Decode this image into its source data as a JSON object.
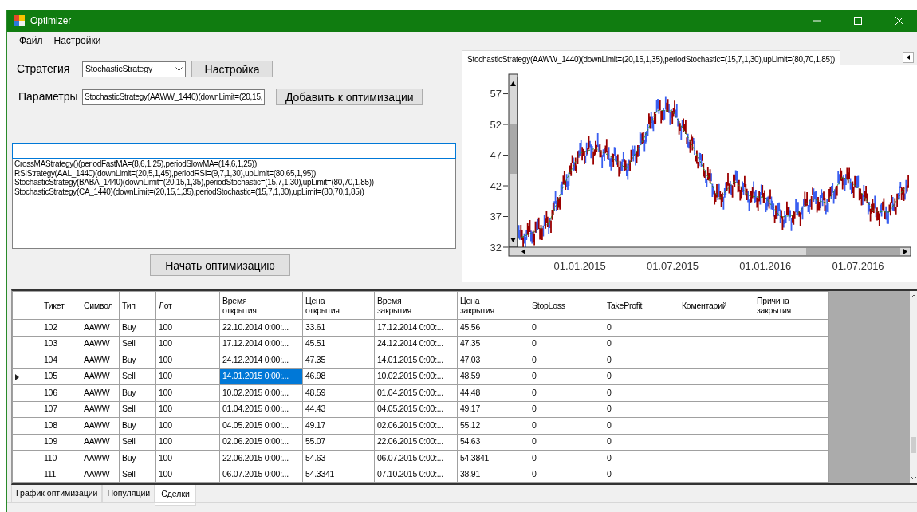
{
  "window": {
    "title": "Optimizer"
  },
  "menu": [
    "Файл",
    "Настройки"
  ],
  "strategy": {
    "label": "Стратегия",
    "value": "StochasticStrategy",
    "settings_button": "Настройка"
  },
  "parameters": {
    "label": "Параметры",
    "value": "StochasticStrategy(AAWW_1440)(downLimit=(20,15,",
    "add_button": "Добавить к оптимизации"
  },
  "filter": {
    "focused": true
  },
  "optimization_list": [
    "CrossMAStrategy()(periodFastMA=(8,6,1,25),periodSlowMA=(14,6,1,25))",
    "RSIStrategy(AAL_1440)(downLimit=(20,5,1,45),periodRSI=(9,7,1,30),upLimit=(80,65,1,95))",
    "StochasticStrategy(BABA_1440)(downLimit=(20,15,1,35),periodStochastic=(15,7,1,30),upLimit=(80,70,1,85))",
    "StochasticStrategy(CA_1440)(downLimit=(20,15,1,35),periodStochastic=(15,7,1,30),upLimit=(80,70,1,85))"
  ],
  "start_button": "Начать оптимизацию",
  "chart": {
    "tab": "StochasticStrategy(AAWW_1440)(downLimit=(20,15,1,35),periodStochastic=(15,7,1,30),upLimit=(80,70,1,85))",
    "chart_data": {
      "type": "line",
      "categories": [
        null,
        null,
        null,
        null,
        "01.01.2015",
        null,
        null,
        null,
        null,
        null,
        "01.07.2015",
        null,
        null,
        null,
        null,
        null,
        "01.01.2016",
        null,
        null,
        null,
        null,
        null,
        "01.07.2016",
        null,
        null,
        null
      ],
      "series": [
        {
          "color": "#2e8b2e",
          "line_style": "dashed",
          "values": [
            33.4,
            34.4,
            35.9,
            42.3,
            47.3,
            48.1,
            46.8,
            44.8,
            49.0,
            54.3,
            54.2,
            49.9,
            44.9,
            39.8,
            42.8,
            40.3,
            40.1,
            36.9,
            37.3,
            39.9,
            39.2,
            43.5,
            41.7,
            37.9,
            37.7,
            41.6
          ]
        }
      ],
      "ylim": [
        32,
        59.8
      ],
      "yticks": [
        32,
        37,
        42,
        47,
        52,
        57
      ]
    }
  },
  "deals_table": {
    "columns": [
      "Тикет",
      "Символ",
      "Тип",
      "Лот",
      "Время открытия",
      "Цена открытия",
      "Время закрытия",
      "Цена закрытия",
      "StopLoss",
      "TakeProfit",
      "Коментарий",
      "Причина закрытия"
    ],
    "rows": [
      {
        "current": false,
        "cells": [
          {
            "text": "102",
            "selected": false
          },
          {
            "text": "AAWW",
            "selected": false
          },
          {
            "text": "Buy",
            "selected": false
          },
          {
            "text": "100",
            "selected": false
          },
          {
            "text": "22.10.2014 0:00:...",
            "selected": false
          },
          {
            "text": "33.61",
            "selected": false
          },
          {
            "text": "17.12.2014 0:00:...",
            "selected": false
          },
          {
            "text": "45.56",
            "selected": false
          },
          {
            "text": "0",
            "selected": false
          },
          {
            "text": "0",
            "selected": false
          },
          {
            "selected": false
          },
          {
            "selected": false
          }
        ]
      },
      {
        "current": false,
        "cells": [
          {
            "text": "103",
            "selected": false
          },
          {
            "text": "AAWW",
            "selected": false
          },
          {
            "text": "Sell",
            "selected": false
          },
          {
            "text": "100",
            "selected": false
          },
          {
            "text": "17.12.2014 0:00:...",
            "selected": false
          },
          {
            "text": "45.51",
            "selected": false
          },
          {
            "text": "24.12.2014 0:00:...",
            "selected": false
          },
          {
            "text": "47.35",
            "selected": false
          },
          {
            "text": "0",
            "selected": false
          },
          {
            "text": "0",
            "selected": false
          },
          {
            "selected": false
          },
          {
            "selected": false
          }
        ]
      },
      {
        "current": false,
        "cells": [
          {
            "text": "104",
            "selected": false
          },
          {
            "text": "AAWW",
            "selected": false
          },
          {
            "text": "Buy",
            "selected": false
          },
          {
            "text": "100",
            "selected": false
          },
          {
            "text": "24.12.2014 0:00:...",
            "selected": false
          },
          {
            "text": "47.35",
            "selected": false
          },
          {
            "text": "14.01.2015 0:00:...",
            "selected": false
          },
          {
            "text": "47.03",
            "selected": false
          },
          {
            "text": "0",
            "selected": false
          },
          {
            "text": "0",
            "selected": false
          },
          {
            "selected": false
          },
          {
            "selected": false
          }
        ]
      },
      {
        "current": true,
        "cells": [
          {
            "text": "105",
            "selected": false
          },
          {
            "text": "AAWW",
            "selected": false
          },
          {
            "text": "Sell",
            "selected": false
          },
          {
            "text": "100",
            "selected": false
          },
          {
            "text": "14.01.2015 0:00:...",
            "selected": true
          },
          {
            "text": "46.98",
            "selected": false
          },
          {
            "text": "10.02.2015 0:00:...",
            "selected": false
          },
          {
            "text": "48.59",
            "selected": false
          },
          {
            "text": "0",
            "selected": false
          },
          {
            "text": "0",
            "selected": false
          },
          {
            "selected": false
          },
          {
            "selected": false
          }
        ]
      },
      {
        "current": false,
        "cells": [
          {
            "text": "106",
            "selected": false
          },
          {
            "text": "AAWW",
            "selected": false
          },
          {
            "text": "Buy",
            "selected": false
          },
          {
            "text": "100",
            "selected": false
          },
          {
            "text": "10.02.2015 0:00:...",
            "selected": false
          },
          {
            "text": "48.59",
            "selected": false
          },
          {
            "text": "01.04.2015 0:00:...",
            "selected": false
          },
          {
            "text": "44.48",
            "selected": false
          },
          {
            "text": "0",
            "selected": false
          },
          {
            "text": "0",
            "selected": false
          },
          {
            "selected": false
          },
          {
            "selected": false
          }
        ]
      },
      {
        "current": false,
        "cells": [
          {
            "text": "107",
            "selected": false
          },
          {
            "text": "AAWW",
            "selected": false
          },
          {
            "text": "Sell",
            "selected": false
          },
          {
            "text": "100",
            "selected": false
          },
          {
            "text": "01.04.2015 0:00:...",
            "selected": false
          },
          {
            "text": "44.43",
            "selected": false
          },
          {
            "text": "04.05.2015 0:00:...",
            "selected": false
          },
          {
            "text": "49.17",
            "selected": false
          },
          {
            "text": "0",
            "selected": false
          },
          {
            "text": "0",
            "selected": false
          },
          {
            "selected": false
          },
          {
            "selected": false
          }
        ]
      },
      {
        "current": false,
        "cells": [
          {
            "text": "108",
            "selected": false
          },
          {
            "text": "AAWW",
            "selected": false
          },
          {
            "text": "Buy",
            "selected": false
          },
          {
            "text": "100",
            "selected": false
          },
          {
            "text": "04.05.2015 0:00:...",
            "selected": false
          },
          {
            "text": "49.17",
            "selected": false
          },
          {
            "text": "02.06.2015 0:00:...",
            "selected": false
          },
          {
            "text": "55.12",
            "selected": false
          },
          {
            "text": "0",
            "selected": false
          },
          {
            "text": "0",
            "selected": false
          },
          {
            "selected": false
          },
          {
            "selected": false
          }
        ]
      },
      {
        "current": false,
        "cells": [
          {
            "text": "109",
            "selected": false
          },
          {
            "text": "AAWW",
            "selected": false
          },
          {
            "text": "Sell",
            "selected": false
          },
          {
            "text": "100",
            "selected": false
          },
          {
            "text": "02.06.2015 0:00:...",
            "selected": false
          },
          {
            "text": "55.07",
            "selected": false
          },
          {
            "text": "22.06.2015 0:00:...",
            "selected": false
          },
          {
            "text": "54.63",
            "selected": false
          },
          {
            "text": "0",
            "selected": false
          },
          {
            "text": "0",
            "selected": false
          },
          {
            "selected": false
          },
          {
            "selected": false
          }
        ]
      },
      {
        "current": false,
        "cells": [
          {
            "text": "110",
            "selected": false
          },
          {
            "text": "AAWW",
            "selected": false
          },
          {
            "text": "Buy",
            "selected": false
          },
          {
            "text": "100",
            "selected": false
          },
          {
            "text": "22.06.2015 0:00:...",
            "selected": false
          },
          {
            "text": "54.63",
            "selected": false
          },
          {
            "text": "06.07.2015 0:00:...",
            "selected": false
          },
          {
            "text": "54.3841",
            "selected": false
          },
          {
            "text": "0",
            "selected": false
          },
          {
            "text": "0",
            "selected": false
          },
          {
            "selected": false
          },
          {
            "selected": false
          }
        ]
      },
      {
        "current": false,
        "cells": [
          {
            "text": "111",
            "selected": false
          },
          {
            "text": "AAWW",
            "selected": false
          },
          {
            "text": "Sell",
            "selected": false
          },
          {
            "text": "100",
            "selected": false
          },
          {
            "text": "06.07.2015 0:00:...",
            "selected": false
          },
          {
            "text": "54.3341",
            "selected": false
          },
          {
            "text": "07.10.2015 0:00:...",
            "selected": false
          },
          {
            "text": "38.91",
            "selected": false
          },
          {
            "text": "0",
            "selected": false
          },
          {
            "text": "0",
            "selected": false
          },
          {
            "selected": false
          },
          {
            "selected": false
          }
        ]
      }
    ]
  },
  "bottom_tabs": [
    {
      "label": "График оптимизации",
      "selected": false
    },
    {
      "label": "Популяции",
      "selected": false
    },
    {
      "label": "Сделки",
      "selected": true
    }
  ]
}
